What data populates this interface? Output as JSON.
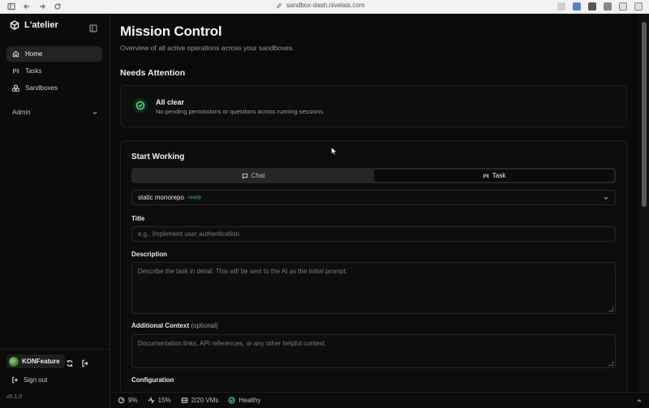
{
  "browser": {
    "url": "sandbox-dash.nivelais.com"
  },
  "sidebar": {
    "brand": "L'atelier",
    "items": [
      {
        "label": "Home",
        "icon": "home-icon",
        "active": true
      },
      {
        "label": "Tasks",
        "icon": "tasks-icon",
        "active": false
      },
      {
        "label": "Sandboxes",
        "icon": "sandboxes-icon",
        "active": false
      }
    ],
    "admin_label": "Admin",
    "user_name": "KONFeature",
    "sign_out": "Sign out",
    "version": "v0.1.0"
  },
  "main": {
    "title": "Mission Control",
    "subtitle": "Overview of all active operations across your sandboxes.",
    "attention": {
      "heading": "Needs Attention",
      "status_title": "All clear",
      "status_text": "No pending permissions or questions across running sessions."
    },
    "work": {
      "heading": "Start Working",
      "modes": [
        {
          "label": "Chat",
          "icon": "chat-icon",
          "selected": false
        },
        {
          "label": "Task",
          "icon": "task-icon",
          "selected": true
        }
      ],
      "repo": {
        "name": "static monorepo",
        "status": "ready"
      },
      "title_label": "Title",
      "title_placeholder": "e.g., Implement user authentication",
      "description_label": "Description",
      "description_placeholder": "Describe the task in detail. This will be sent to the AI as the initial prompt.",
      "context_label": "Additional Context",
      "context_optional": "(optional)",
      "context_placeholder": "Documentation links, API references, or any other helpful context.",
      "configuration_label": "Configuration"
    }
  },
  "status_bar": {
    "cpu": "9%",
    "activity": "15%",
    "vms": "2/20 VMs",
    "health": "Healthy"
  },
  "colors": {
    "accent_green": "#4ade80",
    "ready_green": "#22c55e",
    "background": "#0a0a0a"
  }
}
